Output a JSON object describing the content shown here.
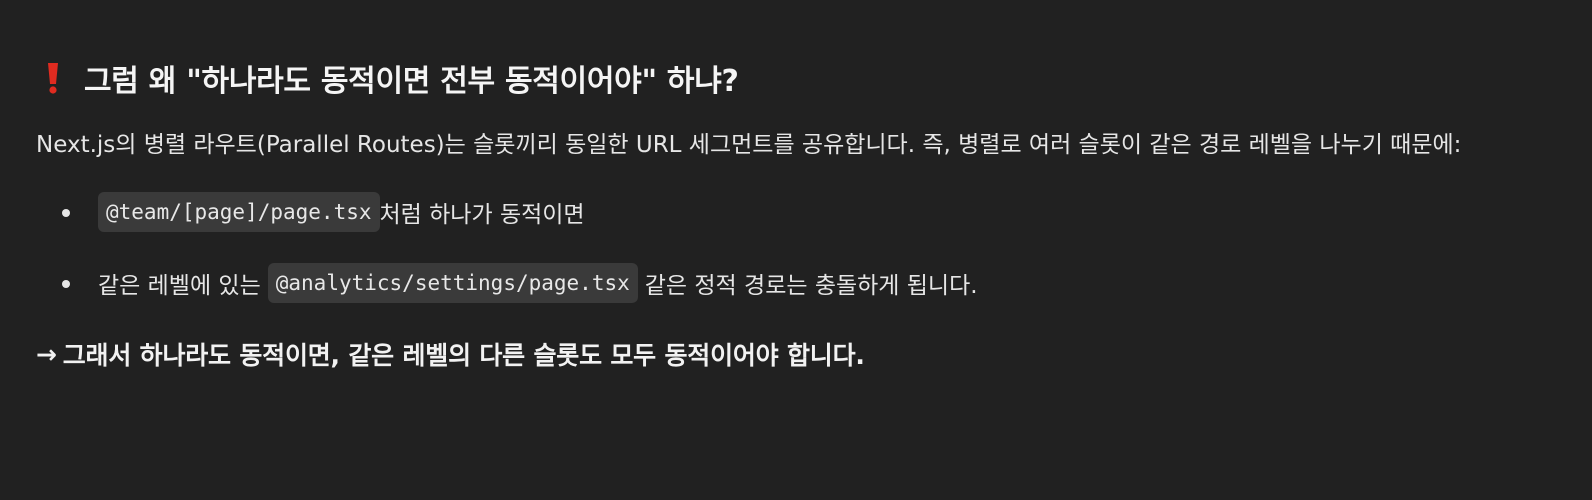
{
  "heading": {
    "icon": "red-exclamation-icon",
    "icon_color": "#e02b20",
    "text": "그럼 왜 \"하나라도 동적이면 전부 동적이어야\" 하냐?"
  },
  "paragraph": {
    "text": "Next.js의 병렬 라우트(Parallel Routes)는 슬롯끼리 동일한 URL 세그먼트를 공유합니다. 즉, 병렬로 여러 슬롯이 같은 경로 레벨을 나누기 때문에:"
  },
  "bullets": [
    {
      "code": "@team/[page]/page.tsx",
      "after": "처럼 하나가 동적이면"
    },
    {
      "before": "같은 레벨에 있는",
      "code": "@analytics/settings/page.tsx",
      "after": "같은 정적 경로는 충돌하게 됩니다."
    }
  ],
  "conclusion": {
    "arrow": "→",
    "text": "그래서 하나라도 동적이면, 같은 레벨의 다른 슬롯도 모두 동적이어야 합니다."
  },
  "colors": {
    "background": "#212121",
    "text": "#e6e6e6",
    "code_background": "#3a3a3a"
  }
}
